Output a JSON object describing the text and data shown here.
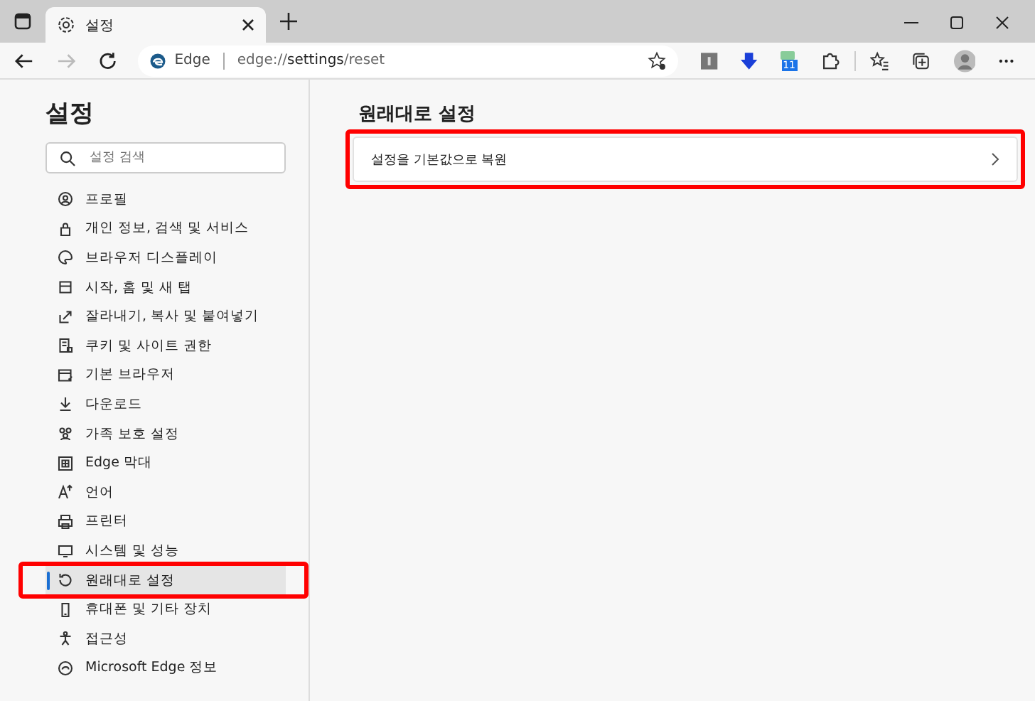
{
  "tab": {
    "title": "설정"
  },
  "address": {
    "site": "Edge",
    "url_prefix": "edge://",
    "url_bold": "settings",
    "url_suffix": "/reset"
  },
  "toolbar": {
    "calendar_badge": "11"
  },
  "sidebar": {
    "title": "설정",
    "search": {
      "placeholder": "설정 검색"
    },
    "items": [
      {
        "label": "프로필",
        "selected": false
      },
      {
        "label": "개인 정보, 검색 및 서비스",
        "selected": false
      },
      {
        "label": "브라우저 디스플레이",
        "selected": false
      },
      {
        "label": "시작, 홈 및 새 탭",
        "selected": false
      },
      {
        "label": "잘라내기, 복사 및 붙여넣기",
        "selected": false
      },
      {
        "label": "쿠키 및 사이트 권한",
        "selected": false
      },
      {
        "label": "기본 브라우저",
        "selected": false
      },
      {
        "label": "다운로드",
        "selected": false
      },
      {
        "label": "가족 보호 설정",
        "selected": false
      },
      {
        "label": "Edge 막대",
        "selected": false
      },
      {
        "label": "언어",
        "selected": false
      },
      {
        "label": "프린터",
        "selected": false
      },
      {
        "label": "시스템 및 성능",
        "selected": false
      },
      {
        "label": "원래대로 설정",
        "selected": true
      },
      {
        "label": "휴대폰 및 기타 장치",
        "selected": false
      },
      {
        "label": "접근성",
        "selected": false
      },
      {
        "label": "Microsoft Edge 정보",
        "selected": false
      }
    ]
  },
  "main": {
    "title": "원래대로 설정",
    "options": [
      {
        "label": "설정을 기본값으로 복원"
      }
    ]
  }
}
